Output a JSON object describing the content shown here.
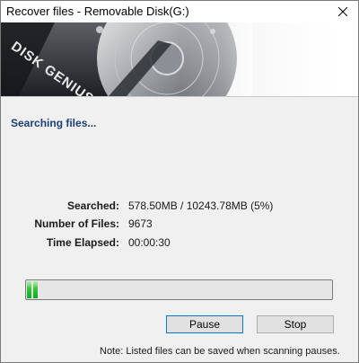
{
  "window": {
    "title": "Recover files - Removable Disk(G:)"
  },
  "banner": {
    "brand_text": "DISK GENIUS"
  },
  "status": {
    "heading": "Searching files..."
  },
  "info": {
    "searched_label": "Searched:",
    "searched_value": "578.50MB / 10243.78MB (5%)",
    "files_label": "Number of Files:",
    "files_value": "9673",
    "elapsed_label": "Time Elapsed:",
    "elapsed_value": "00:00:30"
  },
  "progress": {
    "percent": 5,
    "color": "#06b025"
  },
  "buttons": {
    "pause_label": "Pause",
    "stop_label": "Stop"
  },
  "note": "Note: Listed files can be saved when scanning pauses.",
  "icons": {
    "close": "close-icon",
    "banner": "hard-disk-icon"
  },
  "colors": {
    "heading": "#1a3f73",
    "window_bg": "#f0f0f0",
    "focus_border": "#0078d7"
  }
}
